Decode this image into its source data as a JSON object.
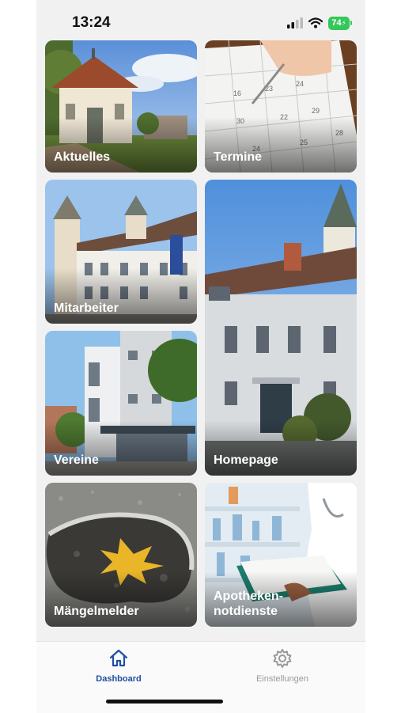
{
  "status_bar": {
    "time": "13:24",
    "battery": "74"
  },
  "tiles": [
    {
      "id": "aktuelles",
      "label": "Aktuelles"
    },
    {
      "id": "termine",
      "label": "Termine"
    },
    {
      "id": "mitarbeiter",
      "label": "Mitarbeiter"
    },
    {
      "id": "homepage",
      "label": "Homepage"
    },
    {
      "id": "vereine",
      "label": "Vereine"
    },
    {
      "id": "maengelmelder",
      "label": "Mängelmelder"
    },
    {
      "id": "apotheken",
      "label": "Apotheken-\nnotdienste"
    }
  ],
  "tabbar": {
    "items": [
      {
        "label": "Dashboard",
        "icon": "home-icon",
        "active": true
      },
      {
        "label": "Einstellungen",
        "icon": "gear-icon",
        "active": false
      }
    ]
  },
  "colors": {
    "accent": "#1f4fa3",
    "inactive": "#9a9a9a",
    "battery": "#34c759"
  }
}
